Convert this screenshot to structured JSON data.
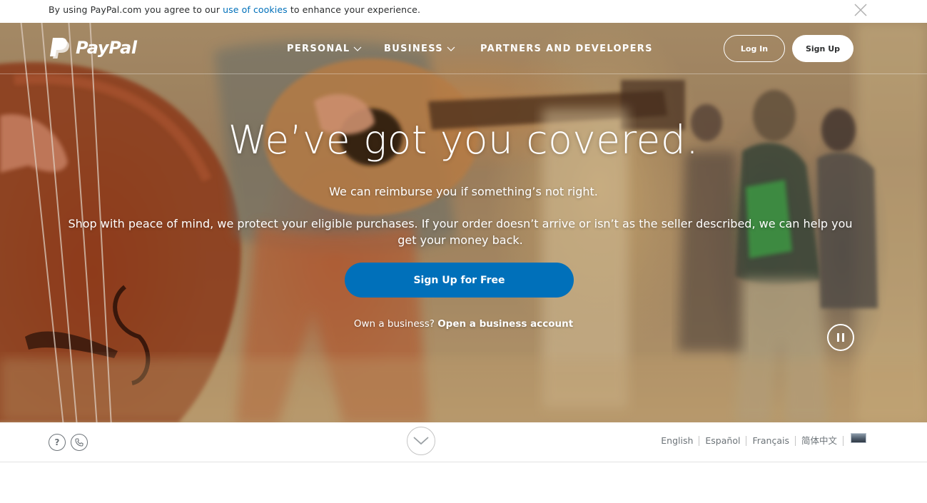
{
  "cookie_bar": {
    "text_before": "By using PayPal.com you agree to our ",
    "link": "use of cookies",
    "text_after": " to enhance your experience.",
    "close_icon": "close-icon"
  },
  "nav": {
    "brand": "PayPal",
    "items": [
      {
        "label": "PERSONAL",
        "has_dropdown": true
      },
      {
        "label": "BUSINESS",
        "has_dropdown": true
      },
      {
        "label": "PARTNERS AND DEVELOPERS",
        "has_dropdown": false
      }
    ],
    "login_label": "Log In",
    "signup_label": "Sign Up"
  },
  "hero": {
    "headline": "We’ve got you covered.",
    "subheadline": "We can reimburse you if something’s not right.",
    "description": "Shop with peace of mind, we protect your eligible purchases. If your order doesn’t arrive or isn’t as the seller described, we can help you get your money back.",
    "cta_label": "Sign Up for Free",
    "business_prompt": "Own a business?",
    "business_link": "Open a business account",
    "video_control_icon": "pause-icon"
  },
  "footer_strip": {
    "help_icon": "help-icon",
    "help_text": "?",
    "phone_icon": "phone-icon",
    "scroll_icon": "chevron-down-icon",
    "languages": [
      "English",
      "Español",
      "Français",
      "简体中文"
    ],
    "flag_icon": "country-flag-icon"
  },
  "colors": {
    "primary_blue": "#0070ba",
    "text_dark": "#2c2e2f",
    "text_gray": "#6c7378"
  }
}
